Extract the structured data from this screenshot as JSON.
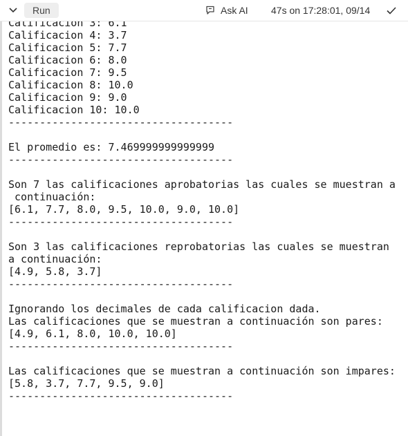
{
  "toolbar": {
    "run_label": "Run",
    "ask_ai_label": "Ask AI",
    "timestamp": "47s on 17:28:01, 09/14",
    "icons": {
      "collapse": "chevron-down-icon",
      "ask_ai": "comment-flag-icon",
      "status": "check-icon"
    }
  },
  "output": {
    "lines": [
      "Calificacion 3: 6.1",
      "Calificacion 4: 3.7",
      "Calificacion 5: 7.7",
      "Calificacion 6: 8.0",
      "Calificacion 7: 9.5",
      "Calificacion 8: 10.0",
      "Calificacion 9: 9.0",
      "Calificacion 10: 10.0",
      "------------------------------------",
      "",
      "El promedio es: 7.469999999999999",
      "------------------------------------",
      "",
      "Son 7 las calificaciones aprobatorias las cuales se muestran a",
      " continuación:",
      "[6.1, 7.7, 8.0, 9.5, 10.0, 9.0, 10.0]",
      "------------------------------------",
      "",
      "Son 3 las calificaciones reprobatorias las cuales se muestran",
      "a continuación:",
      "[4.9, 5.8, 3.7]",
      "------------------------------------",
      "",
      "Ignorando los decimales de cada calificacion dada.",
      "Las calificaciones que se muestran a continuación son pares:",
      "[4.9, 6.1, 8.0, 10.0, 10.0]",
      "------------------------------------",
      "",
      "Las calificaciones que se muestran a continuación son impares:",
      "[5.8, 3.7, 7.7, 9.5, 9.0]",
      "------------------------------------"
    ]
  }
}
